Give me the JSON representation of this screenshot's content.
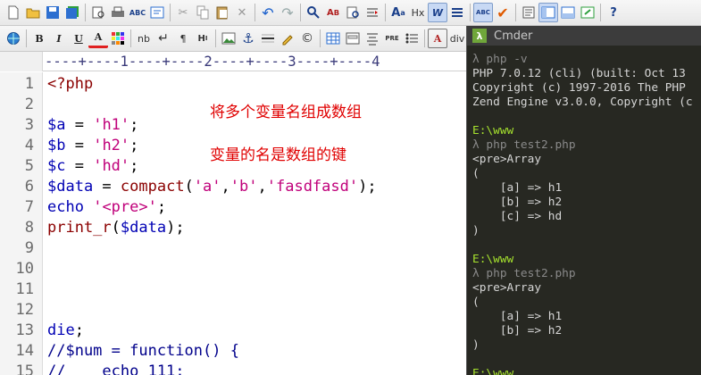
{
  "toolbar1": {
    "buttons": [
      "new-file",
      "open-file",
      "save",
      "save-all",
      "print-preview",
      "print",
      "spell-check",
      "word-wrap",
      "cut",
      "copy",
      "paste",
      "delete",
      "undo",
      "redo",
      "find",
      "find-replace",
      "find-next",
      "goto",
      "font",
      "hex",
      "wordwrap-toggle",
      "line-list",
      "abc-spell",
      "check"
    ],
    "hex_label": "Hx"
  },
  "toolbar2": {
    "bold": "B",
    "italic": "I",
    "underline": "U",
    "font_color": "A",
    "nbsp": "nb",
    "align": "¶",
    "heading": "H",
    "div": "div"
  },
  "ruler": {
    "text": "----+----1----+----2----+----3----+----4"
  },
  "editor": {
    "lines": [
      {
        "n": "1",
        "code": "<?php"
      },
      {
        "n": "2",
        "code": ""
      },
      {
        "n": "3",
        "code": "$a = 'h1';"
      },
      {
        "n": "4",
        "code": "$b = 'h2';"
      },
      {
        "n": "5",
        "code": "$c = 'hd';"
      },
      {
        "n": "6",
        "code": "$data = compact('a','b','fasdfasd');"
      },
      {
        "n": "7",
        "code": "echo '<pre>';"
      },
      {
        "n": "8",
        "code": "print_r($data);"
      },
      {
        "n": "9",
        "code": ""
      },
      {
        "n": "10",
        "code": ""
      },
      {
        "n": "11",
        "code": ""
      },
      {
        "n": "12",
        "code": ""
      },
      {
        "n": "13",
        "code": "die;"
      },
      {
        "n": "14",
        "code": "//$num = function() {"
      },
      {
        "n": "15",
        "code": "//    echo 111;"
      }
    ],
    "annotation1": "将多个变量名组成数组",
    "annotation2": "变量的名是数组的键"
  },
  "cmder": {
    "title": "Cmder",
    "logo": "λ",
    "terminal": "λ php -v\nPHP 7.0.12 (cli) (built: Oct 13\nCopyright (c) 1997-2016 The PHP\nZend Engine v3.0.0, Copyright (c\n\nE:\\www\nλ php test2.php\n<pre>Array\n(\n    [a] => h1\n    [b] => h2\n    [c] => hd\n)\n\nE:\\www\nλ php test2.php\n<pre>Array\n(\n    [a] => h1\n    [b] => h2\n)\n\nE:\\www"
  }
}
